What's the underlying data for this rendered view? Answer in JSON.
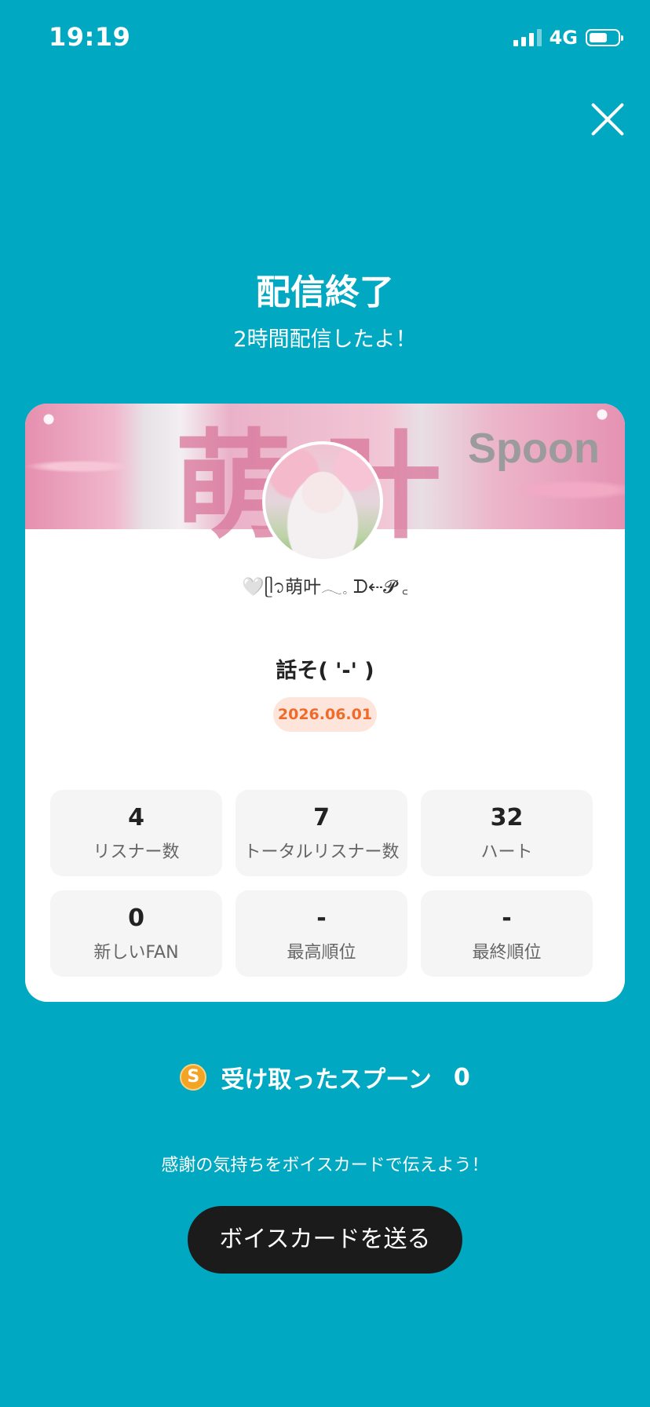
{
  "status_bar": {
    "time": "19:19",
    "network": "4G",
    "battery_level": 0.7
  },
  "header": {
    "title": "配信終了",
    "subtitle": "2時間配信したよ！"
  },
  "card": {
    "banner_text": "萌叶",
    "banner_brand": "Spoon",
    "nickname": "🤍ᥫ᭡萌叶𓂃𓈒 ᗪ⇠𝓟 ꜀",
    "live_title": "話そ( '-' )",
    "date": "2026.06.01",
    "stats": [
      {
        "value": "4",
        "label": "リスナー数"
      },
      {
        "value": "7",
        "label": "トータルリスナー数"
      },
      {
        "value": "32",
        "label": "ハート"
      },
      {
        "value": "0",
        "label": "新しいFAN"
      },
      {
        "value": "-",
        "label": "最高順位"
      },
      {
        "value": "-",
        "label": "最終順位"
      }
    ]
  },
  "spoons": {
    "coin_symbol": "S",
    "label": "受け取ったスプーン",
    "count": "0"
  },
  "thanks_text": "感謝の気持ちをボイスカードで伝えよう！",
  "voice_card_button": "ボイスカードを送る",
  "colors": {
    "background": "#00a9c1",
    "date_badge_bg": "#fde5dc",
    "date_badge_text": "#f06b2a",
    "button_bg": "#1b1b1b"
  }
}
